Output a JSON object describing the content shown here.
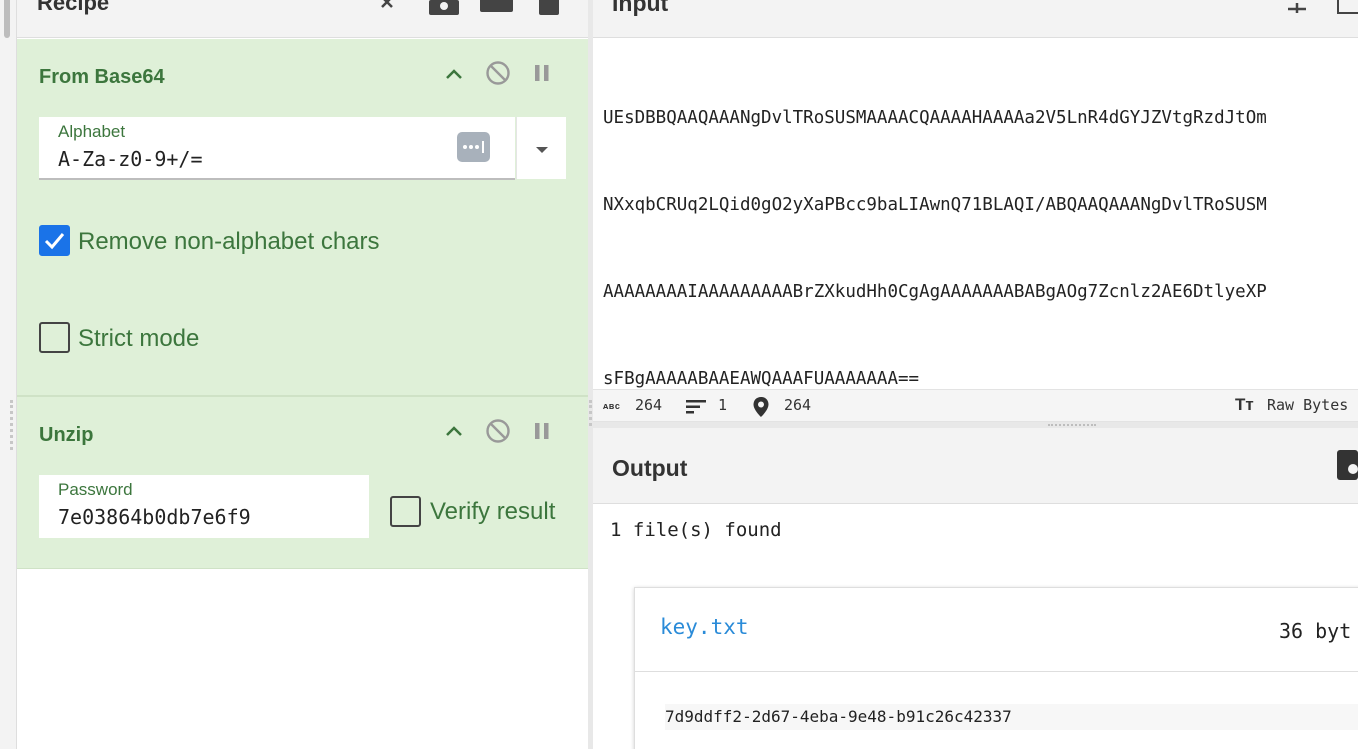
{
  "recipe": {
    "title": "Recipe",
    "operations": [
      {
        "title": "From Base64",
        "alphabet": {
          "label": "Alphabet",
          "value": "A-Za-z0-9+/="
        },
        "remove_non_alphabet": {
          "label": "Remove non-alphabet chars",
          "checked": true
        },
        "strict_mode": {
          "label": "Strict mode",
          "checked": false
        }
      },
      {
        "title": "Unzip",
        "password": {
          "label": "Password",
          "value": "7e03864b0db7e6f9"
        },
        "verify_result": {
          "label": "Verify result",
          "checked": false
        }
      }
    ]
  },
  "input": {
    "title": "Input",
    "lines": [
      "UEsDBBQAAQAAANgDvlTRoSUSMAAAACQAAAAHAAAAa2V5LnR4dGYJZVtgRzdJtOm",
      "NXxqbCRUq2LQid0gO2yXaPBcc9baLIAwnQ71BLAQI/ABQAAQAAANgDvlTRoSUSM",
      "AAAAAAAAIAAAAAAAAABrZXkudHh0CgAgAAAAAAABABgAOg7Zcnlz2AE6DtlyeXP",
      "sFBgAAAAABAAEAWQAAAFUAAAAAAA=="
    ],
    "status": {
      "length": "264",
      "lines": "1",
      "position": "264",
      "encoding": "Raw Bytes"
    }
  },
  "output": {
    "title": "Output",
    "summary": "1 file(s) found",
    "file": {
      "name": "key.txt",
      "size": "36 byt",
      "content": "7d9ddff2-2d67-4eba-9e48-b91c26c42337"
    }
  },
  "icons": {
    "recipe_header": [
      "close-icon",
      "save-icon",
      "folder-icon",
      "trash-icon"
    ],
    "input_header": [
      "add-icon",
      "window-icon"
    ],
    "operation_controls": [
      "chevron-up-icon",
      "disable-icon",
      "pause-icon"
    ],
    "status": [
      "abc-icon",
      "lines-icon",
      "location-pin-icon",
      "font-size-icon"
    ]
  },
  "colors": {
    "op_bg": "#dff0d8",
    "op_text": "#3c763d",
    "checkbox_checked": "#1a73e8",
    "file_link": "#2a8bd8"
  }
}
